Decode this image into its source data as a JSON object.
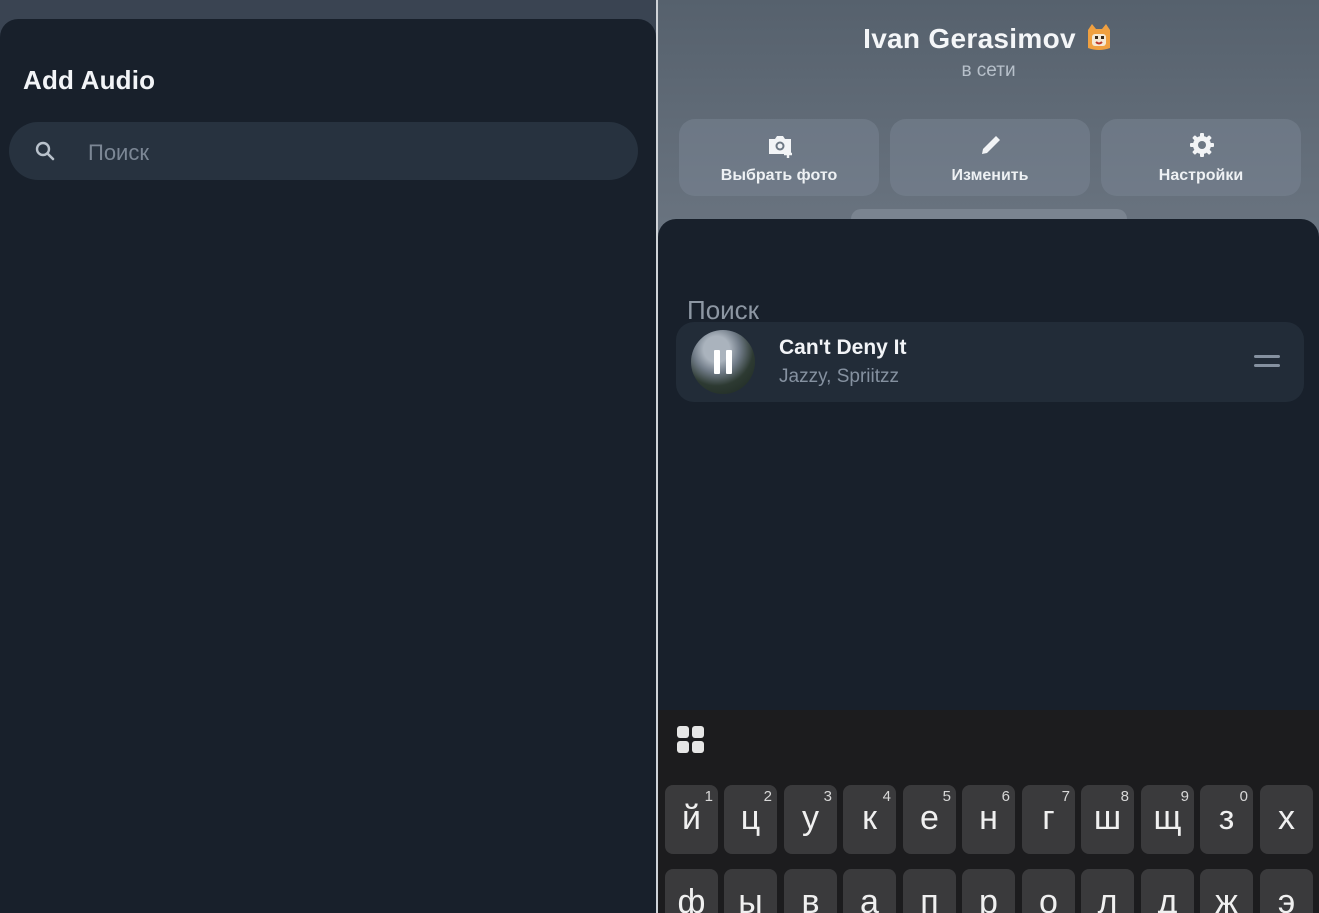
{
  "left_panel": {
    "title": "Add Audio",
    "search": {
      "placeholder": "Поиск",
      "icon": "search-icon"
    }
  },
  "right_panel": {
    "profile": {
      "name": "Ivan Gerasimov",
      "status": "в сети",
      "buttons": [
        {
          "label": "Выбрать фото",
          "icon": "camera-add-icon"
        },
        {
          "label": "Изменить",
          "icon": "pencil-icon"
        },
        {
          "label": "Настройки",
          "icon": "gear-icon"
        }
      ]
    },
    "search_label": "Поиск",
    "track": {
      "title": "Can't Deny It",
      "artist": "Jazzy, Spriitzz",
      "state": "playing"
    },
    "keyboard": {
      "row1": [
        {
          "key": "й",
          "hint": "1"
        },
        {
          "key": "ц",
          "hint": "2"
        },
        {
          "key": "у",
          "hint": "3"
        },
        {
          "key": "к",
          "hint": "4"
        },
        {
          "key": "е",
          "hint": "5"
        },
        {
          "key": "н",
          "hint": "6"
        },
        {
          "key": "г",
          "hint": "7"
        },
        {
          "key": "ш",
          "hint": "8"
        },
        {
          "key": "щ",
          "hint": "9"
        },
        {
          "key": "з",
          "hint": "0"
        },
        {
          "key": "х",
          "hint": ""
        }
      ],
      "row2": [
        {
          "key": "ф"
        },
        {
          "key": "ы"
        },
        {
          "key": "в"
        },
        {
          "key": "а"
        },
        {
          "key": "п"
        },
        {
          "key": "р"
        },
        {
          "key": "о"
        },
        {
          "key": "л"
        },
        {
          "key": "д"
        },
        {
          "key": "ж"
        },
        {
          "key": "э"
        }
      ]
    }
  },
  "colors": {
    "sheet_bg": "#18202b",
    "track_bg": "#222c38",
    "keyboard_bg": "#1c1c1e"
  }
}
